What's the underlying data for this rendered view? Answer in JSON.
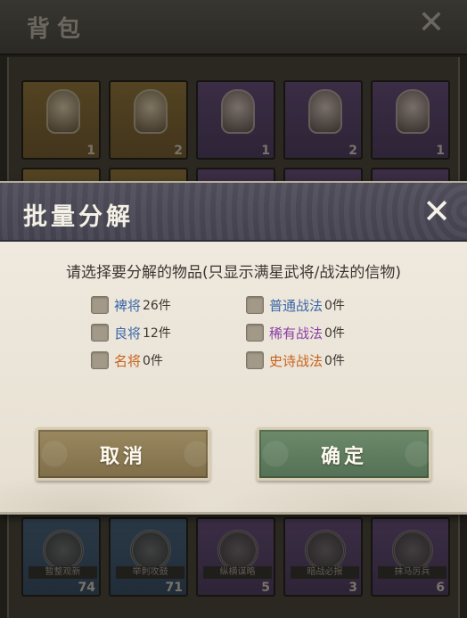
{
  "bag": {
    "title": "背包",
    "close_icon": "close-icon",
    "top_row": [
      {
        "count": "1",
        "tier": "gold"
      },
      {
        "count": "2",
        "tier": "gold"
      },
      {
        "count": "1",
        "tier": "purple"
      },
      {
        "count": "2",
        "tier": "purple"
      },
      {
        "count": "1",
        "tier": "purple"
      }
    ],
    "bottom_row": [
      {
        "name": "暂整观新",
        "count": "74",
        "tier": "blue"
      },
      {
        "name": "举刺攻鼓",
        "count": "71",
        "tier": "blue"
      },
      {
        "name": "纵横谋略",
        "count": "5",
        "tier": "purple"
      },
      {
        "name": "暗战必报",
        "count": "3",
        "tier": "purple"
      },
      {
        "name": "抹马厉兵",
        "count": "6",
        "tier": "purple"
      }
    ]
  },
  "dialog": {
    "title": "批量分解",
    "close_icon": "close-icon",
    "instruction": "请选择要分解的物品(只显示满星武将/战法的信物)",
    "options": [
      {
        "label": "裨将",
        "count": "26件",
        "color": "#3a67a8"
      },
      {
        "label": "良将",
        "count": "12件",
        "color": "#3a67a8"
      },
      {
        "label": "名将",
        "count": "0件",
        "color": "#c8601c"
      },
      {
        "label": "普通战法",
        "count": "0件",
        "color": "#3a67a8"
      },
      {
        "label": "稀有战法",
        "count": "0件",
        "color": "#8a3fa6"
      },
      {
        "label": "史诗战法",
        "count": "0件",
        "color": "#c8601c"
      }
    ],
    "cancel_label": "取消",
    "confirm_label": "确定",
    "colors": {
      "cancel": "#8c7b55",
      "confirm": "#62806a",
      "header": "#4a4855"
    }
  }
}
